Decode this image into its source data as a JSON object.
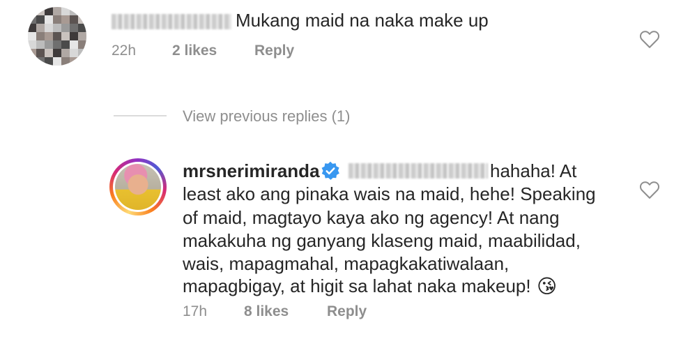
{
  "comment1": {
    "username_blurred": "",
    "text": "Mukang maid na naka make up",
    "time": "22h",
    "likes": "2 likes",
    "reply_label": "Reply"
  },
  "view_replies": "View previous replies (1)",
  "reply1": {
    "username": "mrsnerimiranda",
    "mention_blurred": "",
    "text_line1": "hahaha! At",
    "text_line2": "least ako ang pinaka wais na maid, hehe! Speaking",
    "text_line3": "of maid, magtayo kaya ako ng agency! At nang",
    "text_line4": "makakuha ng ganyang klaseng maid, maabilidad,",
    "text_line5": "wais, mapagmahal, mapagkakatiwalaan,",
    "text_line6": "mapagbigay, at higit sa lahat naka makeup!",
    "emoji": "😘",
    "time": "17h",
    "likes": "8 likes",
    "reply_label": "Reply"
  },
  "icons": {
    "like1": "heart-outline-icon",
    "like2": "heart-outline-icon",
    "verified": "verified-badge-icon"
  },
  "colors": {
    "text": "#262626",
    "meta": "#8e8e8e",
    "verified": "#3897f0",
    "divider": "#dbdbdb"
  }
}
